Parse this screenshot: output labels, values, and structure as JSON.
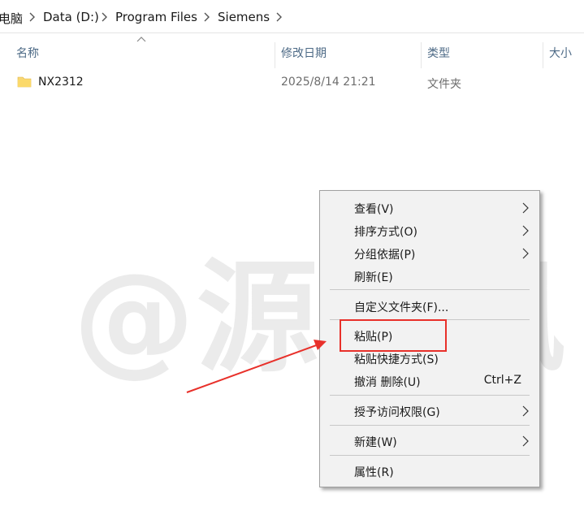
{
  "breadcrumb": {
    "items": [
      "电脑",
      "Data (D:)",
      "Program Files",
      "Siemens"
    ]
  },
  "columns": {
    "name": "名称",
    "modified": "修改日期",
    "type": "类型",
    "size": "大小"
  },
  "files": [
    {
      "name": "NX2312",
      "modified": "2025/8/14 21:21",
      "type": "文件夹",
      "icon": "folder-icon"
    }
  ],
  "watermark": "@源于风",
  "context_menu": {
    "items": [
      {
        "label": "查看(V)",
        "submenu": true
      },
      {
        "label": "排序方式(O)",
        "submenu": true
      },
      {
        "label": "分组依据(P)",
        "submenu": true
      },
      {
        "label": "刷新(E)",
        "submenu": false
      },
      {
        "label": "自定义文件夹(F)...",
        "submenu": false
      },
      {
        "label": "粘贴(P)",
        "submenu": false,
        "highlighted": true
      },
      {
        "label": "粘贴快捷方式(S)",
        "submenu": false
      },
      {
        "label": "撤消 删除(U)",
        "shortcut": "Ctrl+Z"
      },
      {
        "label": "授予访问权限(G)",
        "submenu": true
      },
      {
        "label": "新建(W)",
        "submenu": true
      },
      {
        "label": "属性(R)",
        "submenu": false
      }
    ]
  },
  "colors": {
    "annotation": "#e8302a",
    "folder": "#f8d775",
    "header_text": "#4d6a86",
    "menu_bg": "#f2f2f2"
  }
}
